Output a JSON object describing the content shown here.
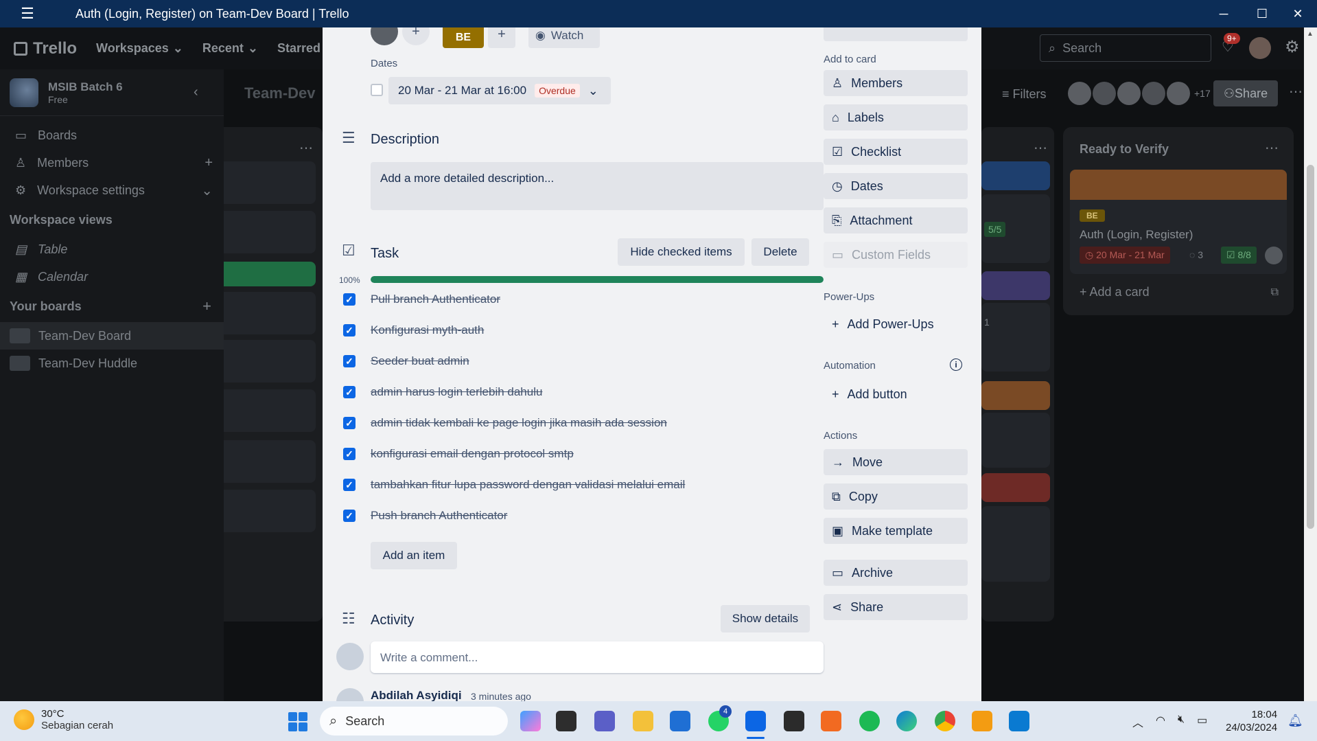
{
  "window": {
    "title": "Auth (Login, Register) on Team-Dev Board | Trello",
    "menu_icon": "hamburger-icon",
    "controls": [
      "─",
      "☐",
      "✕"
    ]
  },
  "appbar": {
    "logo": "Trello",
    "nav": [
      "Workspaces",
      "Recent",
      "Starred"
    ],
    "search_placeholder": "Search",
    "notif_badge": "9+"
  },
  "sidebar": {
    "workspace_name": "MSIB Batch 6",
    "workspace_plan": "Free",
    "items": [
      {
        "label": "Boards"
      },
      {
        "label": "Members"
      },
      {
        "label": "Workspace settings"
      }
    ],
    "views_heading": "Workspace views",
    "views": [
      {
        "label": "Table"
      },
      {
        "label": "Calendar"
      }
    ],
    "boards_heading": "Your boards",
    "boards": [
      {
        "label": "Team-Dev Board"
      },
      {
        "label": "Team-Dev Huddle"
      }
    ]
  },
  "board": {
    "title": "Team-Dev",
    "filters": "Filters",
    "member_extra": "+17",
    "share": "Share",
    "ready_column": {
      "title": "Ready to Verify",
      "card_label": "BE",
      "card_title": "Auth (Login, Register)",
      "card_due": "20 Mar - 21 Mar",
      "card_comments": "3",
      "card_checklist": "8/8",
      "add_card": "Add a card"
    },
    "other_card_checklist": "5/5",
    "other_card_attach": "1"
  },
  "modal": {
    "top_label": "BE",
    "watch": "Watch",
    "dates_heading": "Dates",
    "dates_value": "20 Mar - 21 Mar at 16:00",
    "overdue": "Overdue",
    "description": {
      "title": "Description",
      "placeholder": "Add a more detailed description..."
    },
    "task": {
      "title": "Task",
      "hide_checked": "Hide checked items",
      "delete": "Delete",
      "progress_label": "100%",
      "progress": 1.0,
      "items": [
        "Pull branch Authenticator",
        "Konfigurasi myth-auth",
        "Seeder buat admin",
        "admin harus login terlebih dahulu",
        "admin tidak kembali ke page login jika masih ada session",
        "konfigurasi email dengan protocol smtp",
        "tambahkan fitur lupa password dengan validasi melalui email",
        "Push branch Authenticator"
      ],
      "add_item": "Add an item"
    },
    "activity": {
      "title": "Activity",
      "show_details": "Show details",
      "comment_placeholder": "Write a comment...",
      "entry_author": "Abdilah Asyidiqi",
      "entry_time": "3 minutes ago"
    },
    "side": {
      "add_to_card": "Add to card",
      "add_buttons": [
        "Members",
        "Labels",
        "Checklist",
        "Dates",
        "Attachment",
        "Custom Fields"
      ],
      "powerups_heading": "Power-Ups",
      "add_powerups": "Add Power-Ups",
      "automation_heading": "Automation",
      "add_button": "Add button",
      "actions_heading": "Actions",
      "actions": [
        "Move",
        "Copy",
        "Make template",
        "Archive",
        "Share"
      ]
    }
  },
  "taskbar": {
    "temp": "30°C",
    "weather": "Sebagian cerah",
    "search": "Search",
    "teams_badge": "4",
    "time": "18:04",
    "date": "24/03/2024"
  },
  "colors": {
    "title_bar": "#0c2d57",
    "progress": "#1f845a",
    "checkbox": "#0c66e4",
    "overdue_bg": "#ffeceb",
    "overdue_text": "#ae2e24",
    "label_be": "#946f00"
  }
}
